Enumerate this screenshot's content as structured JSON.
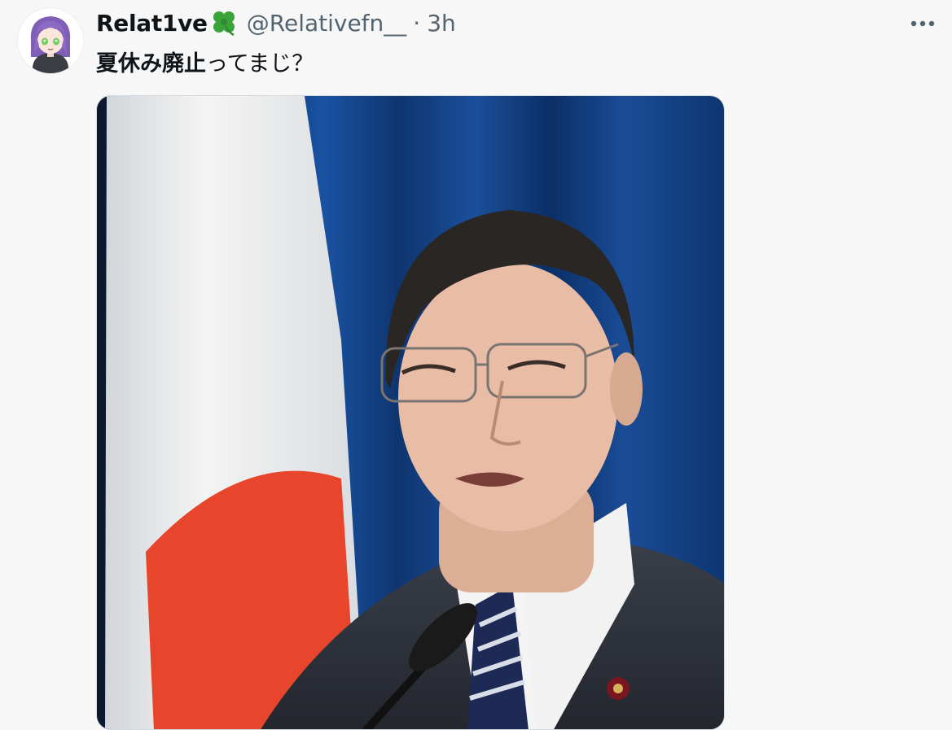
{
  "tweet": {
    "author": {
      "display_name": "Relat1ve",
      "name_emoji_icon": "four-leaf-clover-icon",
      "handle": "@Relativefn__",
      "separator": "·",
      "timestamp": "3h"
    },
    "text": {
      "bold_part": "夏休み廃止",
      "rest": "ってまじ？"
    },
    "more_icon": "ellipsis-horizontal-icon",
    "media": {
      "kind": "photo"
    }
  },
  "colors": {
    "background": "#f7f7f7",
    "text_primary": "#0f1419",
    "text_secondary": "#536471",
    "clover_green": "#3aa33a",
    "flag_red": "#e8452d",
    "curtain_blue": "#123c82"
  }
}
